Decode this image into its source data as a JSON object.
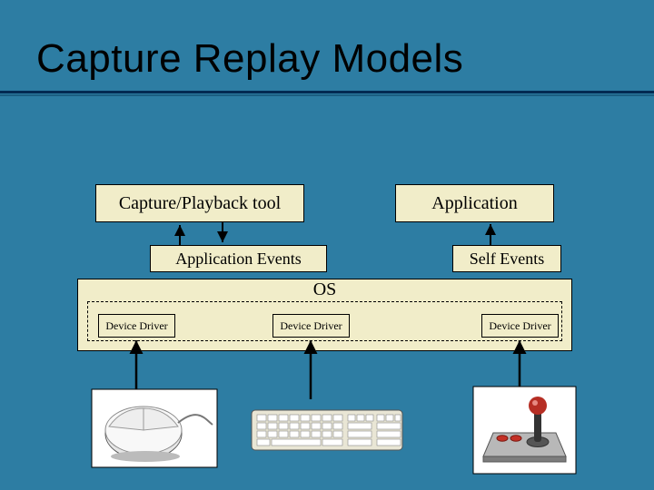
{
  "title": "Capture Replay Models",
  "boxes": {
    "tool": "Capture/Playback tool",
    "application": "Application",
    "app_events": "Application Events",
    "self_events": "Self Events",
    "os": "OS",
    "device_driver": "Device Driver"
  }
}
